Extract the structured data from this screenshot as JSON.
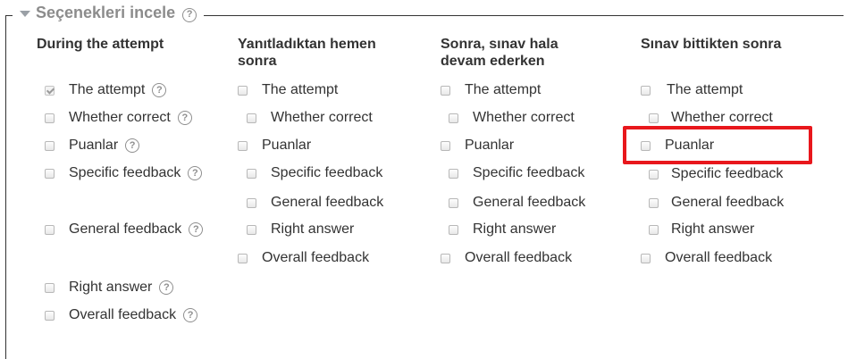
{
  "legend": {
    "title": "Seçenekleri incele"
  },
  "columns": [
    {
      "header": "During the attempt",
      "options": [
        {
          "label": "The attempt",
          "checked": true,
          "disabled": true,
          "help": true
        },
        {
          "label": "Whether correct",
          "checked": false,
          "disabled": true,
          "help": true
        },
        {
          "label": "Puanlar",
          "checked": false,
          "disabled": true,
          "help": true
        },
        {
          "label": "Specific feedback",
          "checked": false,
          "disabled": true,
          "help": true
        },
        {
          "label": "General feedback",
          "checked": false,
          "disabled": true,
          "help": true
        },
        {
          "label": "Right answer",
          "checked": false,
          "disabled": true,
          "help": true
        },
        {
          "label": "Overall feedback",
          "checked": false,
          "disabled": true,
          "help": true
        }
      ]
    },
    {
      "header": "Yanıtladıktan hemen sonra",
      "options": [
        {
          "label": "The attempt",
          "checked": false
        },
        {
          "label": "Whether correct",
          "checked": false,
          "disabled": true
        },
        {
          "label": "Puanlar",
          "checked": false
        },
        {
          "label": "Specific feedback",
          "checked": false,
          "disabled": true
        },
        {
          "label": "General feedback",
          "checked": false,
          "disabled": true
        },
        {
          "label": "Right answer",
          "checked": false,
          "disabled": true
        },
        {
          "label": "Overall feedback",
          "checked": false
        }
      ]
    },
    {
      "header": "Sonra, sınav hala devam ederken",
      "options": [
        {
          "label": "The attempt",
          "checked": false
        },
        {
          "label": "Whether correct",
          "checked": false,
          "disabled": true
        },
        {
          "label": "Puanlar",
          "checked": false
        },
        {
          "label": "Specific feedback",
          "checked": false,
          "disabled": true
        },
        {
          "label": "General feedback",
          "checked": false,
          "disabled": true
        },
        {
          "label": "Right answer",
          "checked": false,
          "disabled": true
        },
        {
          "label": "Overall feedback",
          "checked": false
        }
      ]
    },
    {
      "header": "Sınav bittikten sonra",
      "options": [
        {
          "label": "The attempt",
          "checked": false
        },
        {
          "label": "Whether correct",
          "checked": false,
          "disabled": true
        },
        {
          "label": "Puanlar",
          "checked": false,
          "highlighted": true
        },
        {
          "label": "Specific feedback",
          "checked": false,
          "disabled": true
        },
        {
          "label": "General feedback",
          "checked": false,
          "disabled": true
        },
        {
          "label": "Right answer",
          "checked": false,
          "disabled": true
        },
        {
          "label": "Overall feedback",
          "checked": false
        }
      ]
    }
  ],
  "colors": {
    "highlight": "#e8171c",
    "text": "#333333",
    "legend": "#8c8c8c"
  }
}
